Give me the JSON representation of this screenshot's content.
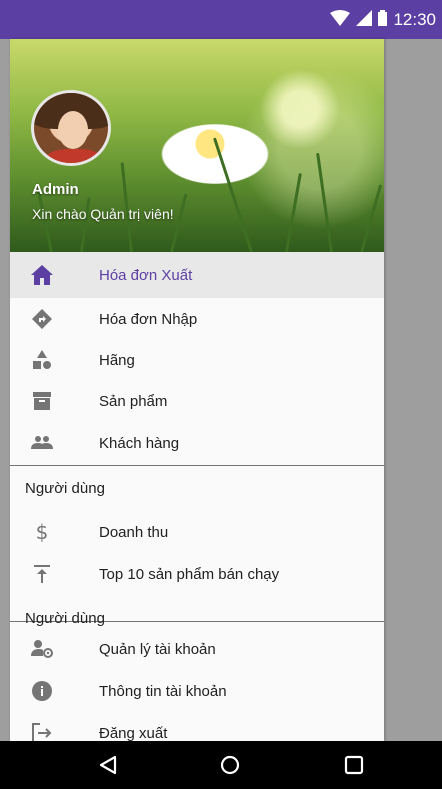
{
  "status_bar": {
    "time": "12:30",
    "icons": [
      "wifi-icon",
      "signal-icon",
      "battery-icon"
    ],
    "color": "#5c3fa3"
  },
  "drawer": {
    "header": {
      "name": "Admin",
      "greeting": "Xin chào Quản trị viên!"
    },
    "menu_primary": [
      {
        "label": "Hóa đơn Xuất",
        "icon": "home-icon",
        "active": true
      },
      {
        "label": "Hóa đơn Nhập",
        "icon": "directions-icon",
        "active": false
      },
      {
        "label": "Hãng",
        "icon": "category-icon",
        "active": false
      },
      {
        "label": "Sản phẩm",
        "icon": "archive-icon",
        "active": false
      },
      {
        "label": "Khách hàng",
        "icon": "people-icon",
        "active": false
      }
    ],
    "section_1": {
      "title": "Người dùng",
      "items": [
        {
          "label": "Doanh thu",
          "icon": "dollar-icon"
        },
        {
          "label": "Top 10 sản phẩm bán chạy",
          "icon": "vertical-align-top-icon"
        }
      ]
    },
    "section_2": {
      "title": "Người dùng",
      "items": [
        {
          "label": "Quản lý tài khoản",
          "icon": "manage-accounts-icon"
        },
        {
          "label": "Thông tin tài khoản",
          "icon": "info-icon"
        },
        {
          "label": "Đăng xuất",
          "icon": "logout-icon"
        }
      ]
    },
    "accent_color": "#5c3fa3"
  },
  "navigation_bar": {
    "buttons": [
      "back-icon",
      "home-circle-icon",
      "recents-icon"
    ]
  }
}
